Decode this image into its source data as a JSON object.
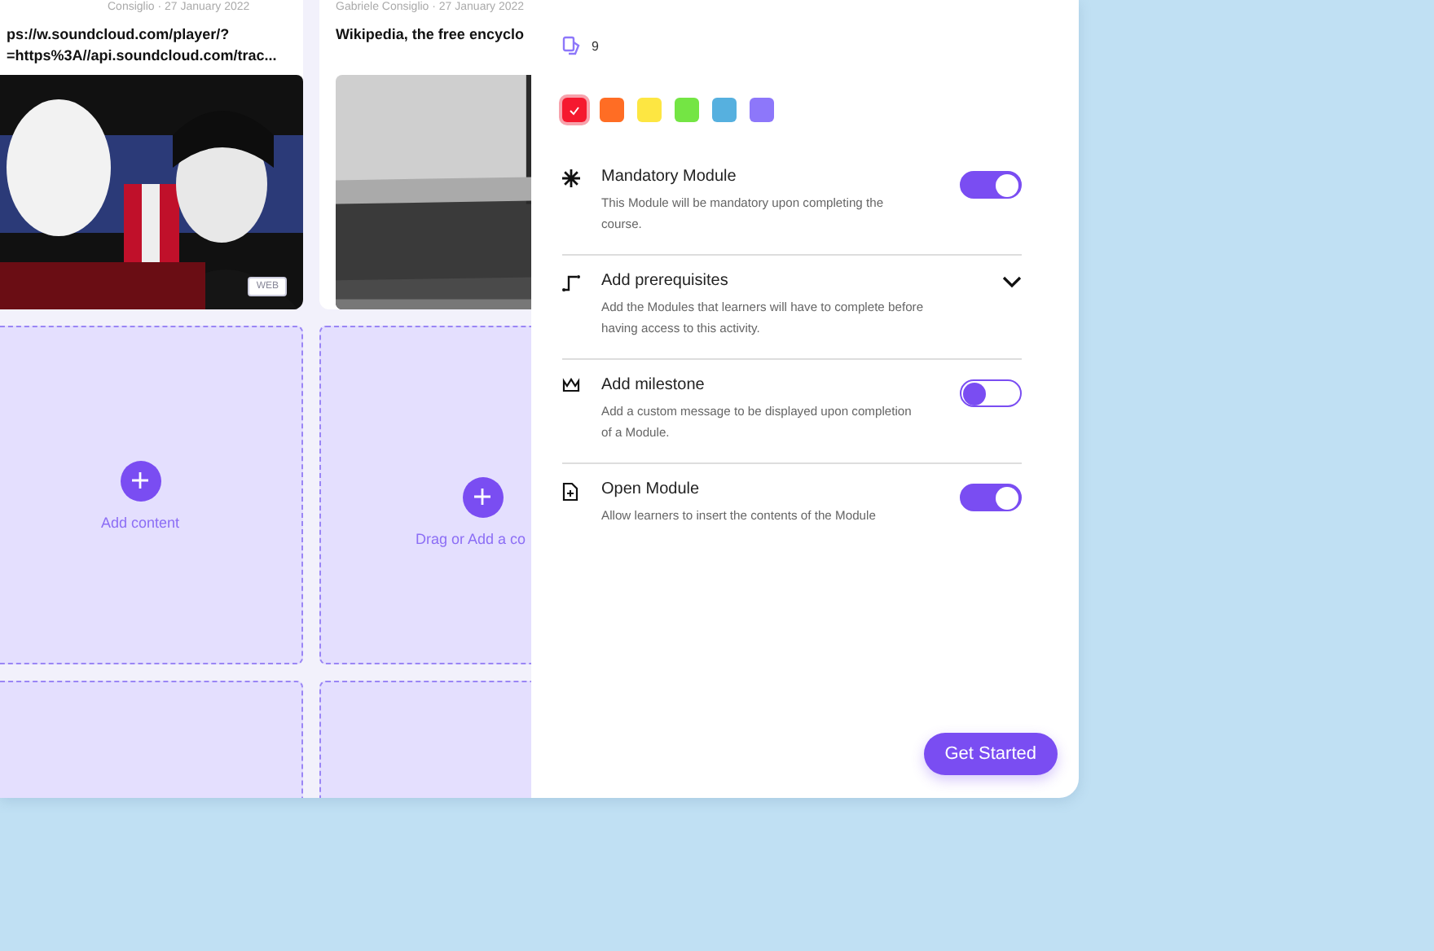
{
  "cards": [
    {
      "meta": "Consiglio · 27 January 2022",
      "title": "ps://w.soundcloud.com/player/?\n=https%3A//api.soundcloud.com/trac...",
      "badge": "WEB"
    },
    {
      "meta": "Gabriele Consiglio · 27 January 2022",
      "title": "Wikipedia, the free encyclo"
    }
  ],
  "dropzones": [
    {
      "label": "Add content"
    },
    {
      "label": "Drag or Add a co"
    }
  ],
  "panel": {
    "count": "9",
    "colors": [
      {
        "color": "#f5192f",
        "selected": true
      },
      {
        "color": "#ff6d24",
        "selected": false
      },
      {
        "color": "#fde642",
        "selected": false
      },
      {
        "color": "#74e544",
        "selected": false
      },
      {
        "color": "#56b0df",
        "selected": false
      },
      {
        "color": "#8d77fa",
        "selected": false
      }
    ],
    "settings": [
      {
        "kind": "toggle",
        "title": "Mandatory Module",
        "description": "This Module will be mandatory upon completing the course.",
        "on": true
      },
      {
        "kind": "expander",
        "title": "Add prerequisites",
        "description": "Add the Modules that learners will have to complete before having access to this activity.",
        "expanded": false
      },
      {
        "kind": "toggle",
        "title": "Add milestone",
        "description": "Add a custom message to be displayed upon completion of a Module.",
        "on": false
      },
      {
        "kind": "toggle",
        "title": "Open Module",
        "description": "Allow learners to insert the contents of the Module",
        "on": true
      }
    ],
    "button": "Get Started"
  }
}
